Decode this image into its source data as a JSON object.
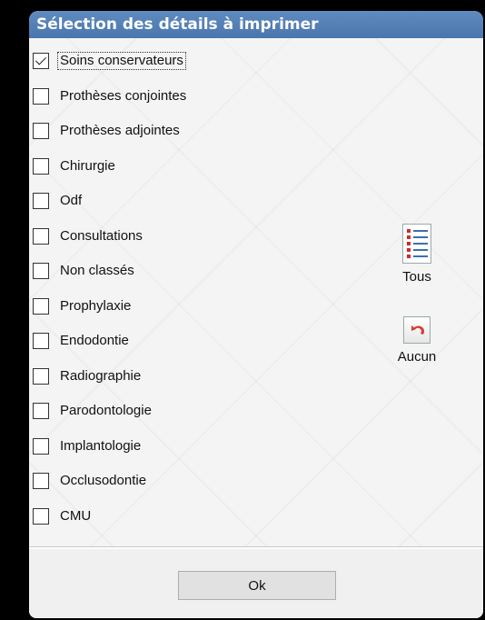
{
  "window": {
    "title": "Sélection des détails à imprimer"
  },
  "items": [
    {
      "label": "Soins conservateurs",
      "checked": true
    },
    {
      "label": "Prothèses conjointes",
      "checked": false
    },
    {
      "label": "Prothèses adjointes",
      "checked": false
    },
    {
      "label": "Chirurgie",
      "checked": false
    },
    {
      "label": "Odf",
      "checked": false
    },
    {
      "label": "Consultations",
      "checked": false
    },
    {
      "label": "Non classés",
      "checked": false
    },
    {
      "label": "Prophylaxie",
      "checked": false
    },
    {
      "label": "Endodontie",
      "checked": false
    },
    {
      "label": "Radiographie",
      "checked": false
    },
    {
      "label": "Parodontologie",
      "checked": false
    },
    {
      "label": "Implantologie",
      "checked": false
    },
    {
      "label": "Occlusodontie",
      "checked": false
    },
    {
      "label": "CMU",
      "checked": false
    }
  ],
  "buttons": {
    "select_all": {
      "label": "Tous",
      "icon": "list-icon"
    },
    "select_none": {
      "label": "Aucun",
      "icon": "undo-icon"
    },
    "ok": {
      "label": "Ok"
    }
  },
  "colors": {
    "titlebar": "#4a76ad",
    "undo_arrow": "#d93a2f",
    "list_bullet": "#d02a2a"
  }
}
